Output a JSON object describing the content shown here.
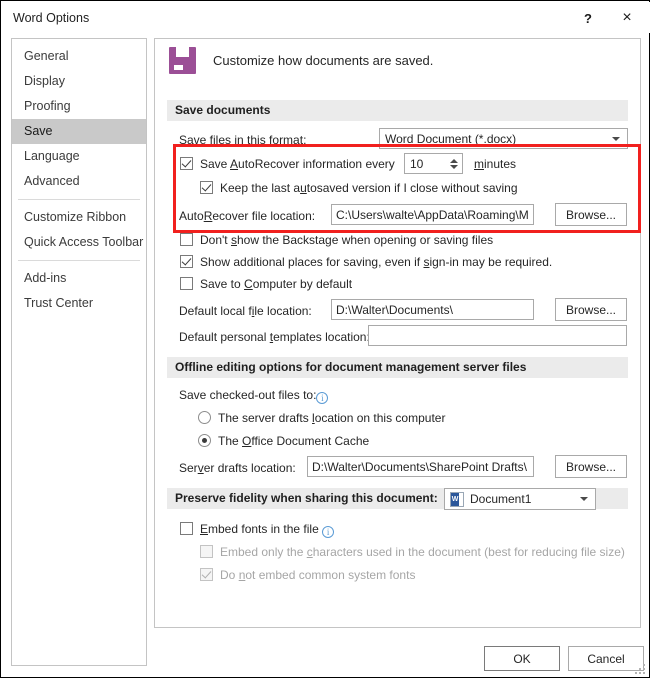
{
  "window": {
    "title": "Word Options",
    "help_icon": "?",
    "close_icon": "×"
  },
  "sidebar": {
    "items": [
      {
        "label": "General",
        "selected": false
      },
      {
        "label": "Display",
        "selected": false
      },
      {
        "label": "Proofing",
        "selected": false
      },
      {
        "label": "Save",
        "selected": true
      },
      {
        "label": "Language",
        "selected": false
      },
      {
        "label": "Advanced",
        "selected": false
      },
      {
        "label": "Customize Ribbon",
        "selected": false
      },
      {
        "label": "Quick Access Toolbar",
        "selected": false
      },
      {
        "label": "Add-ins",
        "selected": false
      },
      {
        "label": "Trust Center",
        "selected": false
      }
    ]
  },
  "panel": {
    "header": {
      "icon": "save-floppy-icon",
      "text": "Customize how documents are saved."
    },
    "save_documents": {
      "group_title": "Save documents",
      "format_label": "Save files in this format:",
      "format_value": "Word Document (*.docx)",
      "autorecover_label_pre": "Save ",
      "autorecover_label_key": "A",
      "autorecover_label_post": "utoRecover information every",
      "autorecover_checked": true,
      "autorecover_minutes": "10",
      "minutes_label_key": "m",
      "minutes_label_post": "inutes",
      "keep_autosaved_checked": true,
      "keep_autosaved_label": "Keep the last autosaved version if I close without saving",
      "autorecover_location_label": "AutoRecover file location:",
      "autorecover_location_value": "C:\\Users\\walte\\AppData\\Roaming\\Micr",
      "autorecover_browse": "Browse...",
      "backstage_checked": false,
      "backstage_label": "Don't show the Backstage when opening or saving files",
      "additional_places_checked": true,
      "additional_places_label": "Show additional places for saving, even if sign-in may be required.",
      "save_to_computer_checked": false,
      "save_to_computer_label": "Save to Computer by default",
      "default_local_label": "Default local file location:",
      "default_local_value": "D:\\Walter\\Documents\\",
      "default_local_browse": "Browse...",
      "default_templates_label": "Default personal templates location:",
      "default_templates_value": ""
    },
    "offline_editing": {
      "group_title": "Offline editing options for document management server files",
      "checked_out_label": "Save checked-out files to:",
      "info_icon": "i",
      "option_server_drafts": "The server drafts location on this computer",
      "option_office_cache": "The Office Document Cache",
      "selected_option": "office_cache",
      "server_drafts_label": "Server drafts location:",
      "server_drafts_value": "D:\\Walter\\Documents\\SharePoint Drafts\\",
      "server_drafts_browse": "Browse..."
    },
    "preserve_fidelity": {
      "group_title": "Preserve fidelity when sharing this document:",
      "document_value": "Document1",
      "document_icon": "word-document-icon",
      "embed_fonts_checked": false,
      "embed_fonts_label": "Embed fonts in the file",
      "embed_fonts_info_icon": "i",
      "embed_chars_checked": false,
      "embed_chars_enabled": false,
      "embed_chars_label": "Embed only the characters used in the document (best for reducing file size)",
      "no_common_fonts_checked": true,
      "no_common_fonts_enabled": false,
      "no_common_fonts_label": "Do not embed common system fonts"
    }
  },
  "footer": {
    "ok_label": "OK",
    "cancel_label": "Cancel"
  },
  "annotation": {
    "highlight_color": "#f1201e"
  }
}
